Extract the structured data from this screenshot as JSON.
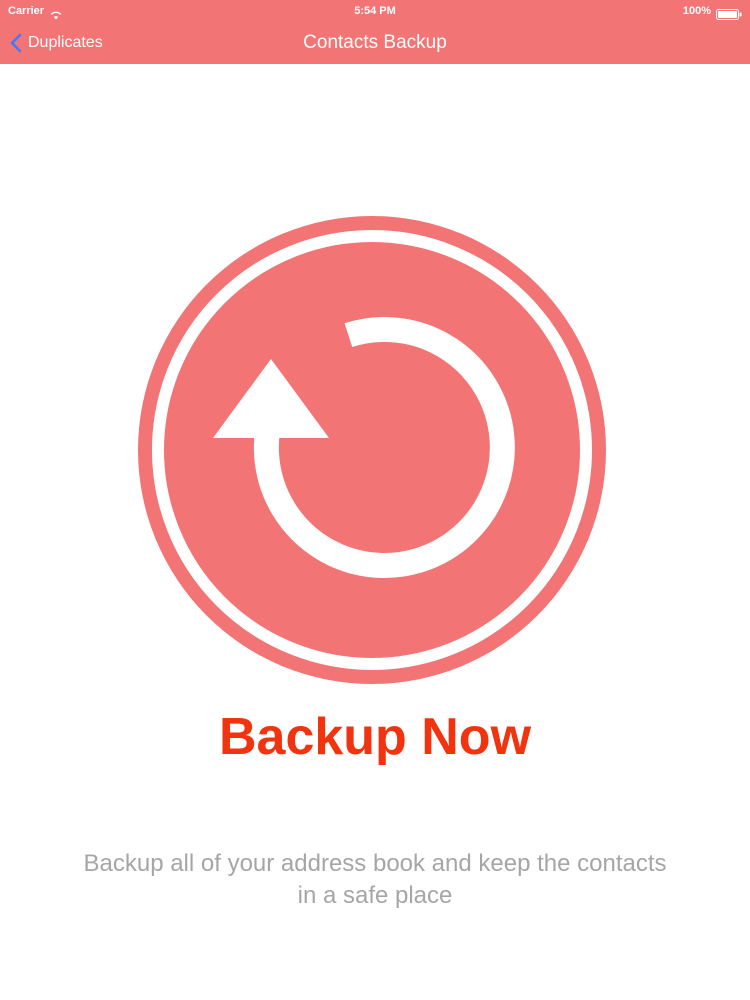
{
  "status_bar": {
    "carrier": "Carrier",
    "time": "5:54 PM",
    "battery": "100%",
    "wifi_icon": "wifi-icon",
    "battery_icon": "battery-icon"
  },
  "nav_bar": {
    "back_label": "Duplicates",
    "back_icon": "chevron-left-icon",
    "title": "Contacts Backup"
  },
  "main": {
    "circle_icon": "refresh-icon",
    "action_label": "Backup Now",
    "description": "Backup all of your address book and keep the contacts in a safe place"
  },
  "colors": {
    "accent": "#f37474",
    "action_text": "#f1330f",
    "description_text": "#a6a6a6",
    "background": "#ffffff"
  }
}
